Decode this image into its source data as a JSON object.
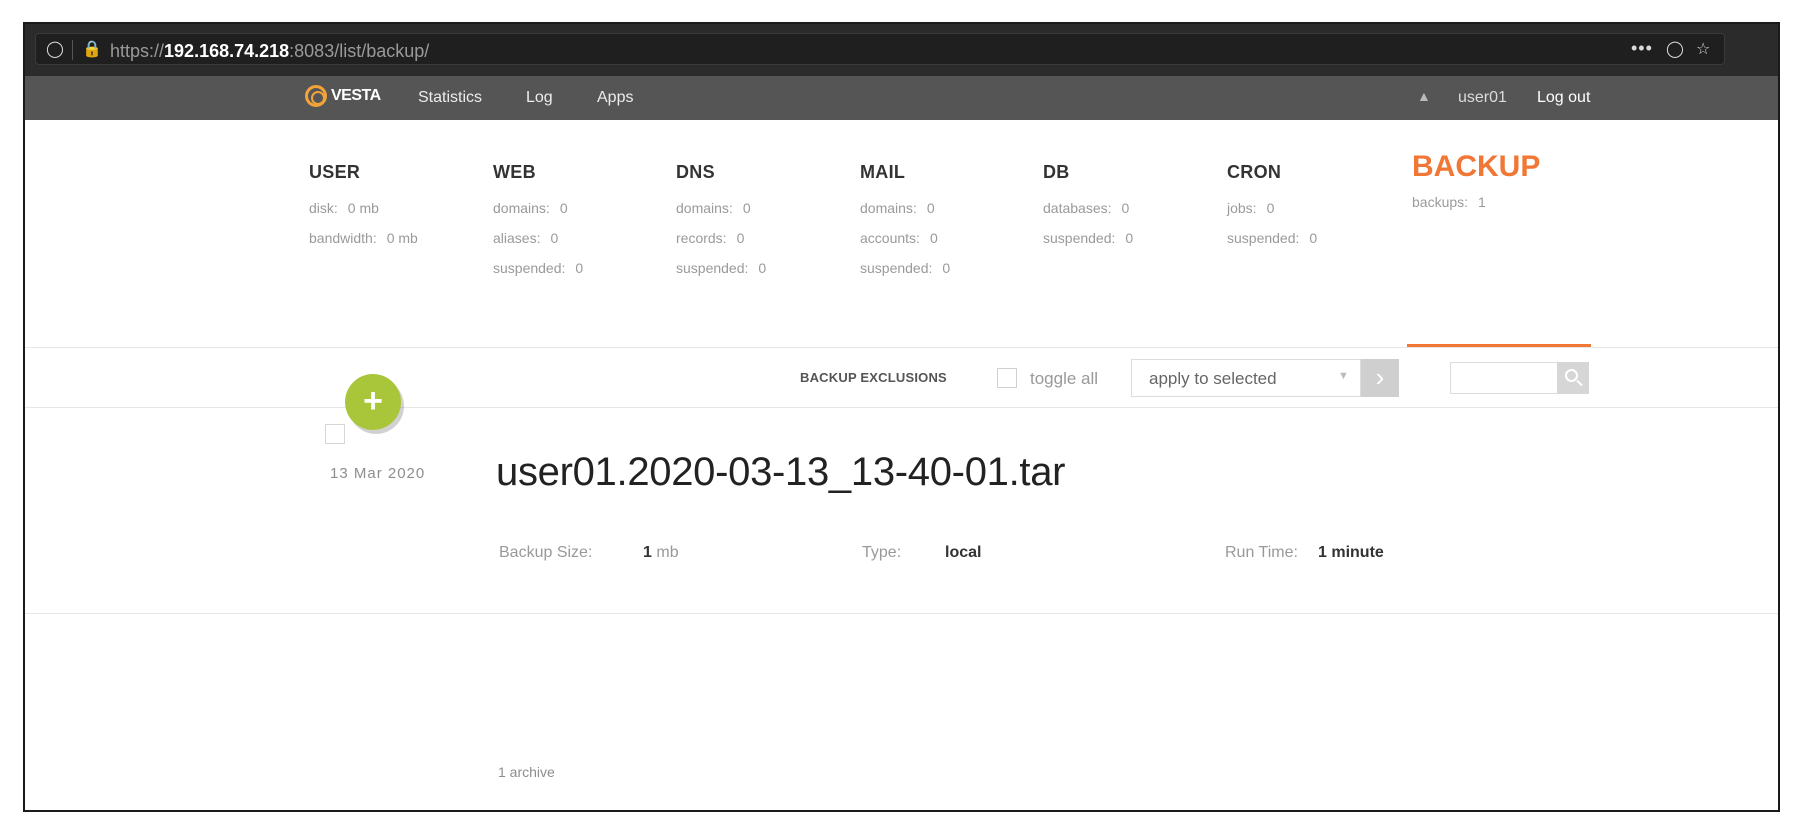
{
  "browser": {
    "url_prefix": "https://",
    "url_host": "192.168.74.218",
    "url_rest": ":8083/list/backup/",
    "icons": [
      "shield-icon",
      "lock-warning-icon",
      "more-icon",
      "pocket-icon",
      "star-icon"
    ]
  },
  "topnav": {
    "logo_text": "VESTA",
    "statistics": "Statistics",
    "log": "Log",
    "apps": "Apps",
    "user": "user01",
    "logout": "Log out"
  },
  "stats": {
    "user": {
      "title": "USER",
      "rows": [
        {
          "k": "disk:",
          "v": "0 mb"
        },
        {
          "k": "bandwidth:",
          "v": "0 mb"
        }
      ]
    },
    "web": {
      "title": "WEB",
      "rows": [
        {
          "k": "domains:",
          "v": "0"
        },
        {
          "k": "aliases:",
          "v": "0"
        },
        {
          "k": "suspended:",
          "v": "0"
        }
      ]
    },
    "dns": {
      "title": "DNS",
      "rows": [
        {
          "k": "domains:",
          "v": "0"
        },
        {
          "k": "records:",
          "v": "0"
        },
        {
          "k": "suspended:",
          "v": "0"
        }
      ]
    },
    "mail": {
      "title": "MAIL",
      "rows": [
        {
          "k": "domains:",
          "v": "0"
        },
        {
          "k": "accounts:",
          "v": "0"
        },
        {
          "k": "suspended:",
          "v": "0"
        }
      ]
    },
    "db": {
      "title": "DB",
      "rows": [
        {
          "k": "databases:",
          "v": "0"
        },
        {
          "k": "suspended:",
          "v": "0"
        }
      ]
    },
    "cron": {
      "title": "CRON",
      "rows": [
        {
          "k": "jobs:",
          "v": "0"
        },
        {
          "k": "suspended:",
          "v": "0"
        }
      ]
    },
    "backup": {
      "title": "BACKUP",
      "rows": [
        {
          "k": "backups:",
          "v": "1"
        }
      ]
    }
  },
  "toolbar": {
    "exclusions": "BACKUP EXCLUSIONS",
    "toggle_all": "toggle all",
    "apply_selected": "apply to selected",
    "search_placeholder": ""
  },
  "backup_item": {
    "date": "13 Mar 2020",
    "name": "user01.2020-03-13_13-40-01.tar",
    "size_label": "Backup Size:",
    "size_value": "1",
    "size_unit": "mb",
    "type_label": "Type:",
    "type_value": "local",
    "runtime_label": "Run Time:",
    "runtime_value": "1 minute"
  },
  "footer": {
    "count": "1 archive"
  },
  "colors": {
    "accent": "#f07735",
    "add_button": "#a9c63a",
    "topnav": "#555555"
  }
}
